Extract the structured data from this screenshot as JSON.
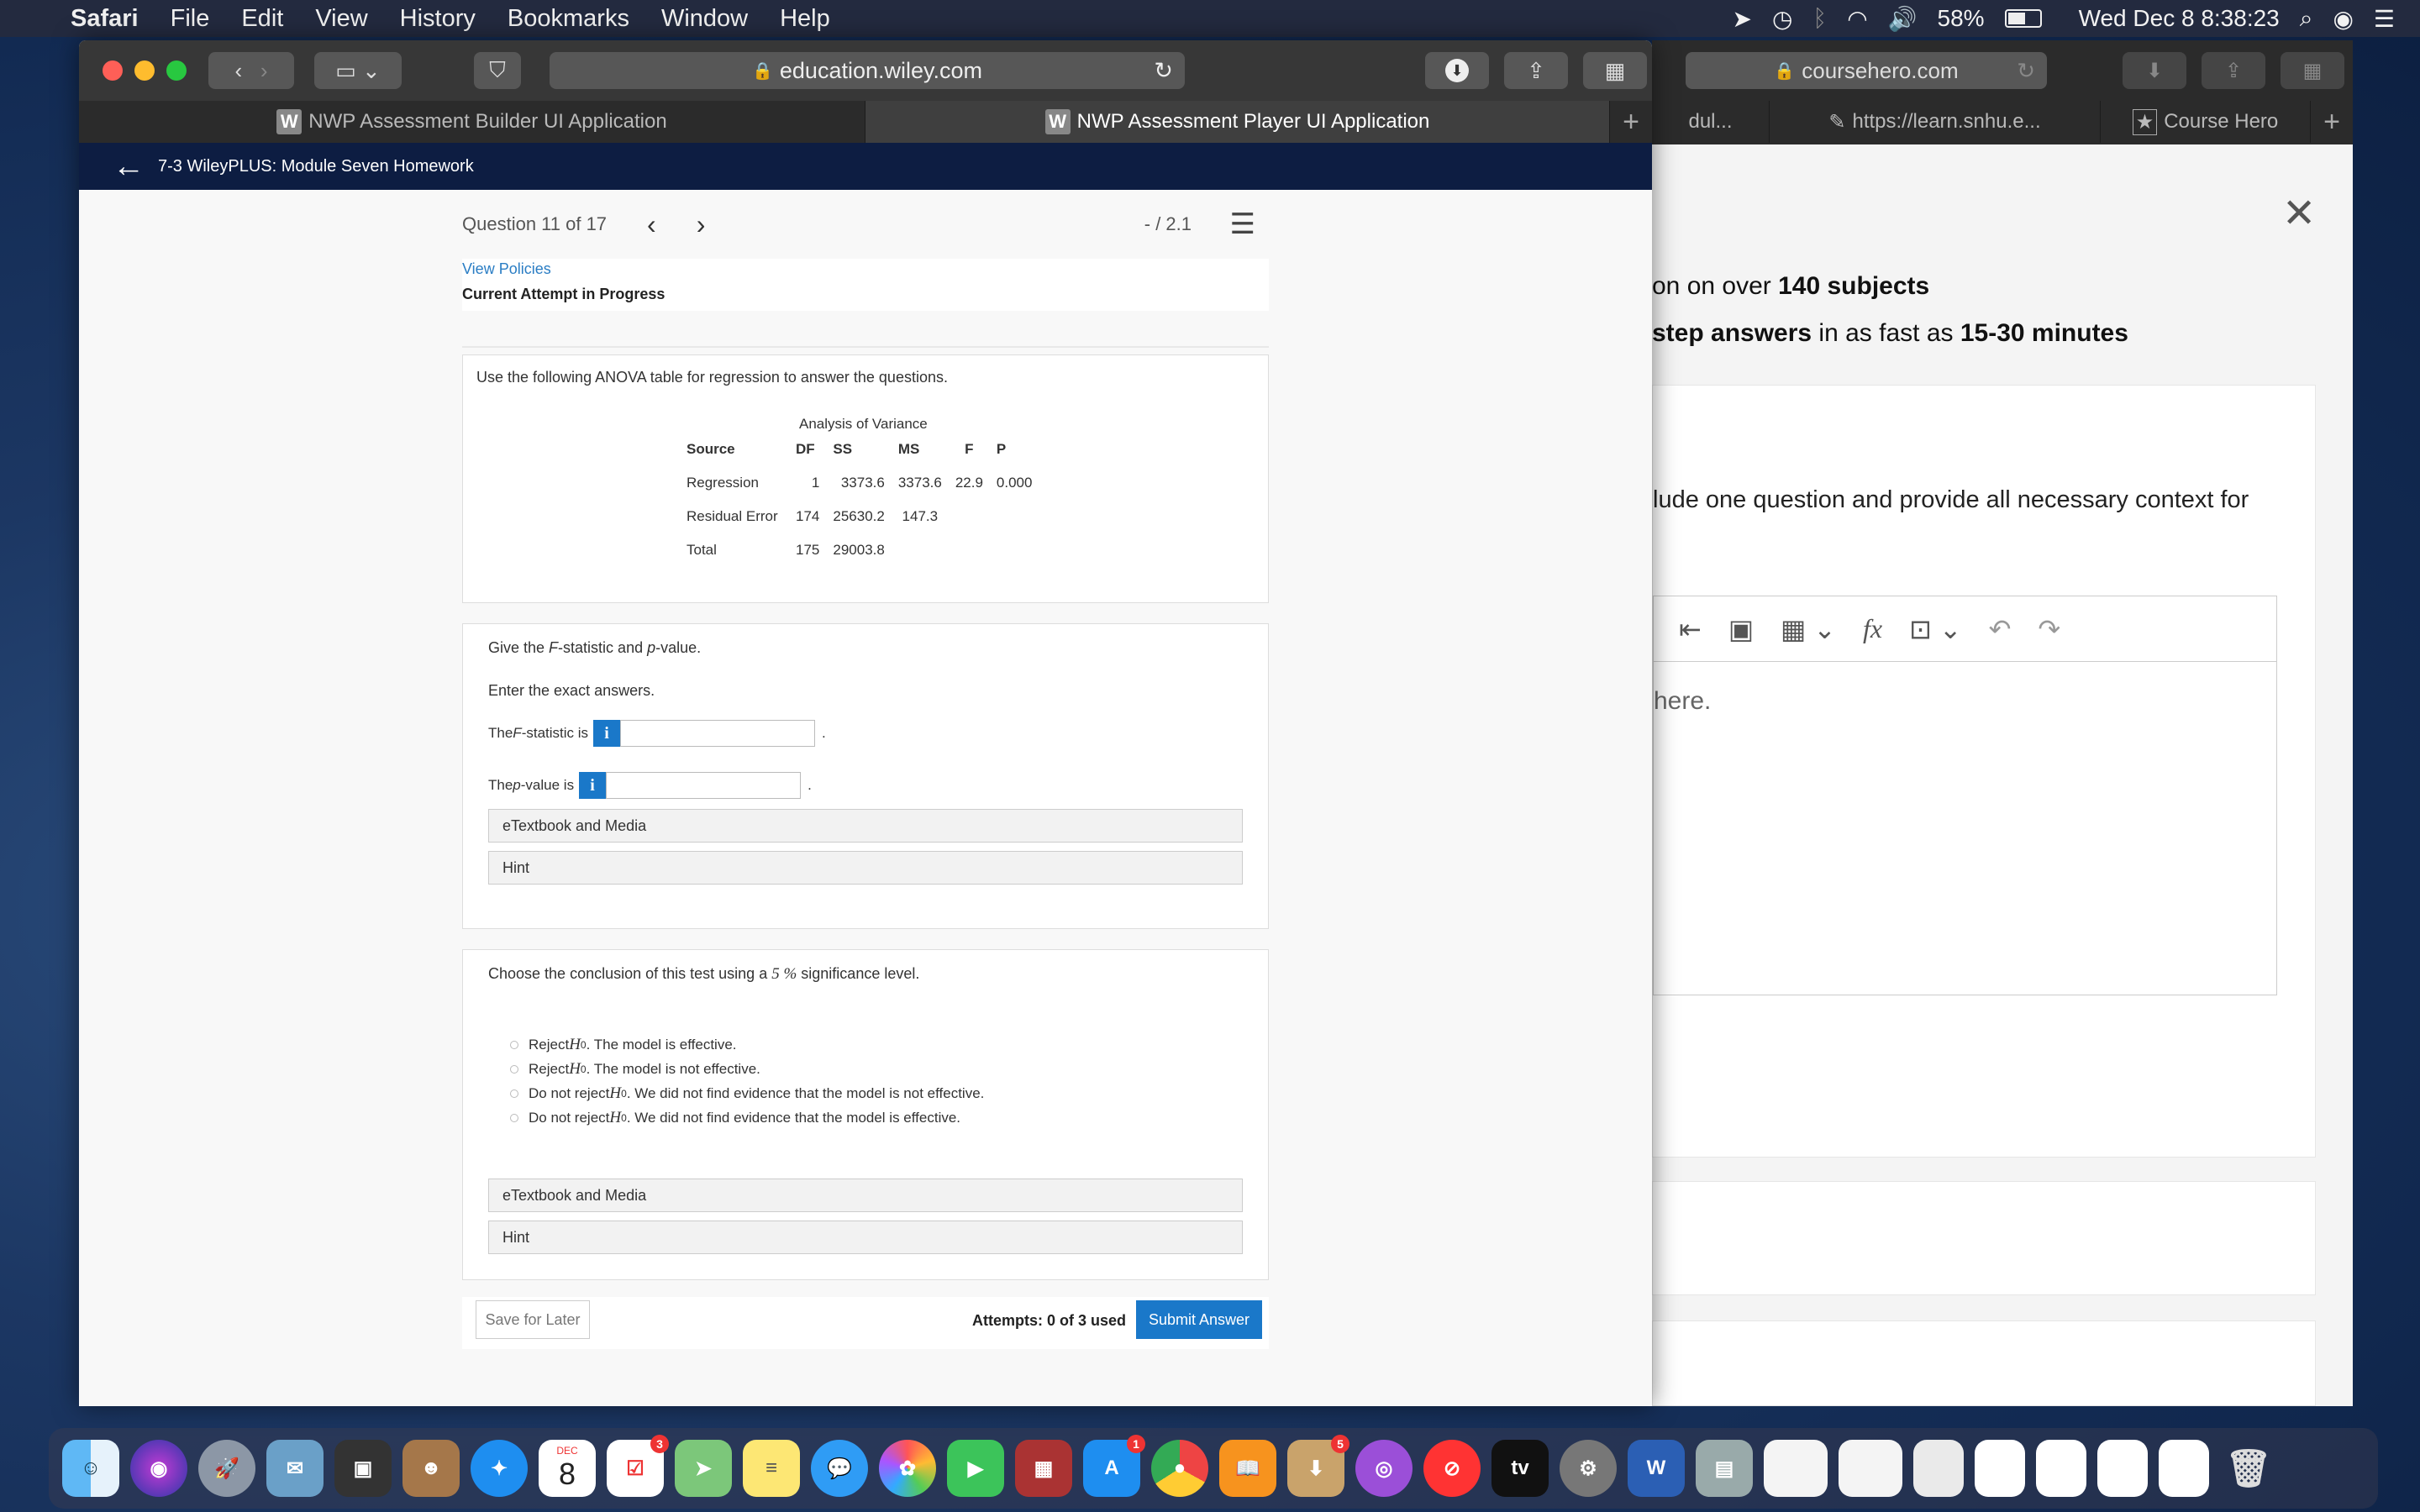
{
  "menubar": {
    "app": "Safari",
    "items": [
      "File",
      "Edit",
      "View",
      "History",
      "Bookmarks",
      "Window",
      "Help"
    ],
    "battery": "58%",
    "datetime": "Wed Dec 8  8:38:23"
  },
  "browser": {
    "url": "education.wiley.com",
    "tabs": [
      "NWP Assessment Builder UI Application",
      "NWP Assessment Player UI Application"
    ],
    "tab_icon": "W"
  },
  "course_hero": {
    "url": "coursehero.com",
    "tabs": [
      "dul...",
      "https://learn.snhu.e...",
      "Course Hero"
    ],
    "line1_a": "on on over ",
    "line1_b": "140 subjects",
    "line2_a": "step answers",
    "line2_b": " in as fast as ",
    "line2_c": "15-30 minutes",
    "line3": "lude one question and provide all necessary context for",
    "placeholder": "here."
  },
  "header": {
    "title": "7-3 WileyPLUS: Module Seven Homework"
  },
  "question": {
    "nav": "Question 11 of 17",
    "score": "- / 2.1",
    "view_policies": "View Policies",
    "attempt_status": "Current Attempt in Progress",
    "intro": "Use the following ANOVA table for regression to answer the questions.",
    "anova": {
      "caption": "Analysis of Variance",
      "headers": [
        "Source",
        "DF",
        "SS",
        "MS",
        "F",
        "P"
      ],
      "rows": [
        [
          "Regression",
          "1",
          "3373.6",
          "3373.6",
          "22.9",
          "0.000"
        ],
        [
          "Residual Error",
          "174",
          "25630.2",
          "147.3",
          "",
          ""
        ],
        [
          "Total",
          "175",
          "29003.8",
          "",
          "",
          ""
        ]
      ]
    },
    "part1": {
      "prompt_a": "Give the ",
      "prompt_f": "F",
      "prompt_b": "-statistic and ",
      "prompt_p": "p",
      "prompt_c": "-value.",
      "instruction": "Enter the exact answers.",
      "f_label_a": "The ",
      "f_label_f": "F",
      "f_label_b": "-statistic is",
      "p_label_a": "The ",
      "p_label_p": "p",
      "p_label_b": "-value is",
      "info": "i",
      "period": ".",
      "etextbook": "eTextbook and Media",
      "hint": "Hint"
    },
    "part2": {
      "prompt_a": "Choose the conclusion of this test using a ",
      "prompt_val": "5 %",
      "prompt_b": " significance level.",
      "options": [
        {
          "a": "Reject ",
          "h": "H",
          "sub": "0",
          "b": ". The model is effective."
        },
        {
          "a": "Reject ",
          "h": "H",
          "sub": "0",
          "b": ". The model is not effective."
        },
        {
          "a": "Do not reject ",
          "h": "H",
          "sub": "0",
          "b": ". We did not find evidence that the model is not effective."
        },
        {
          "a": "Do not reject ",
          "h": "H",
          "sub": "0",
          "b": ". We did not find evidence that the model is effective."
        }
      ],
      "etextbook": "eTextbook and Media",
      "hint": "Hint"
    },
    "footer": {
      "save": "Save for Later",
      "attempts": "Attempts: 0 of 3 used",
      "submit": "Submit Answer"
    }
  },
  "dock": {
    "calendar_month": "DEC",
    "calendar_day": "8",
    "badges": [
      "3",
      "1",
      "5"
    ],
    "tv": "tv"
  }
}
